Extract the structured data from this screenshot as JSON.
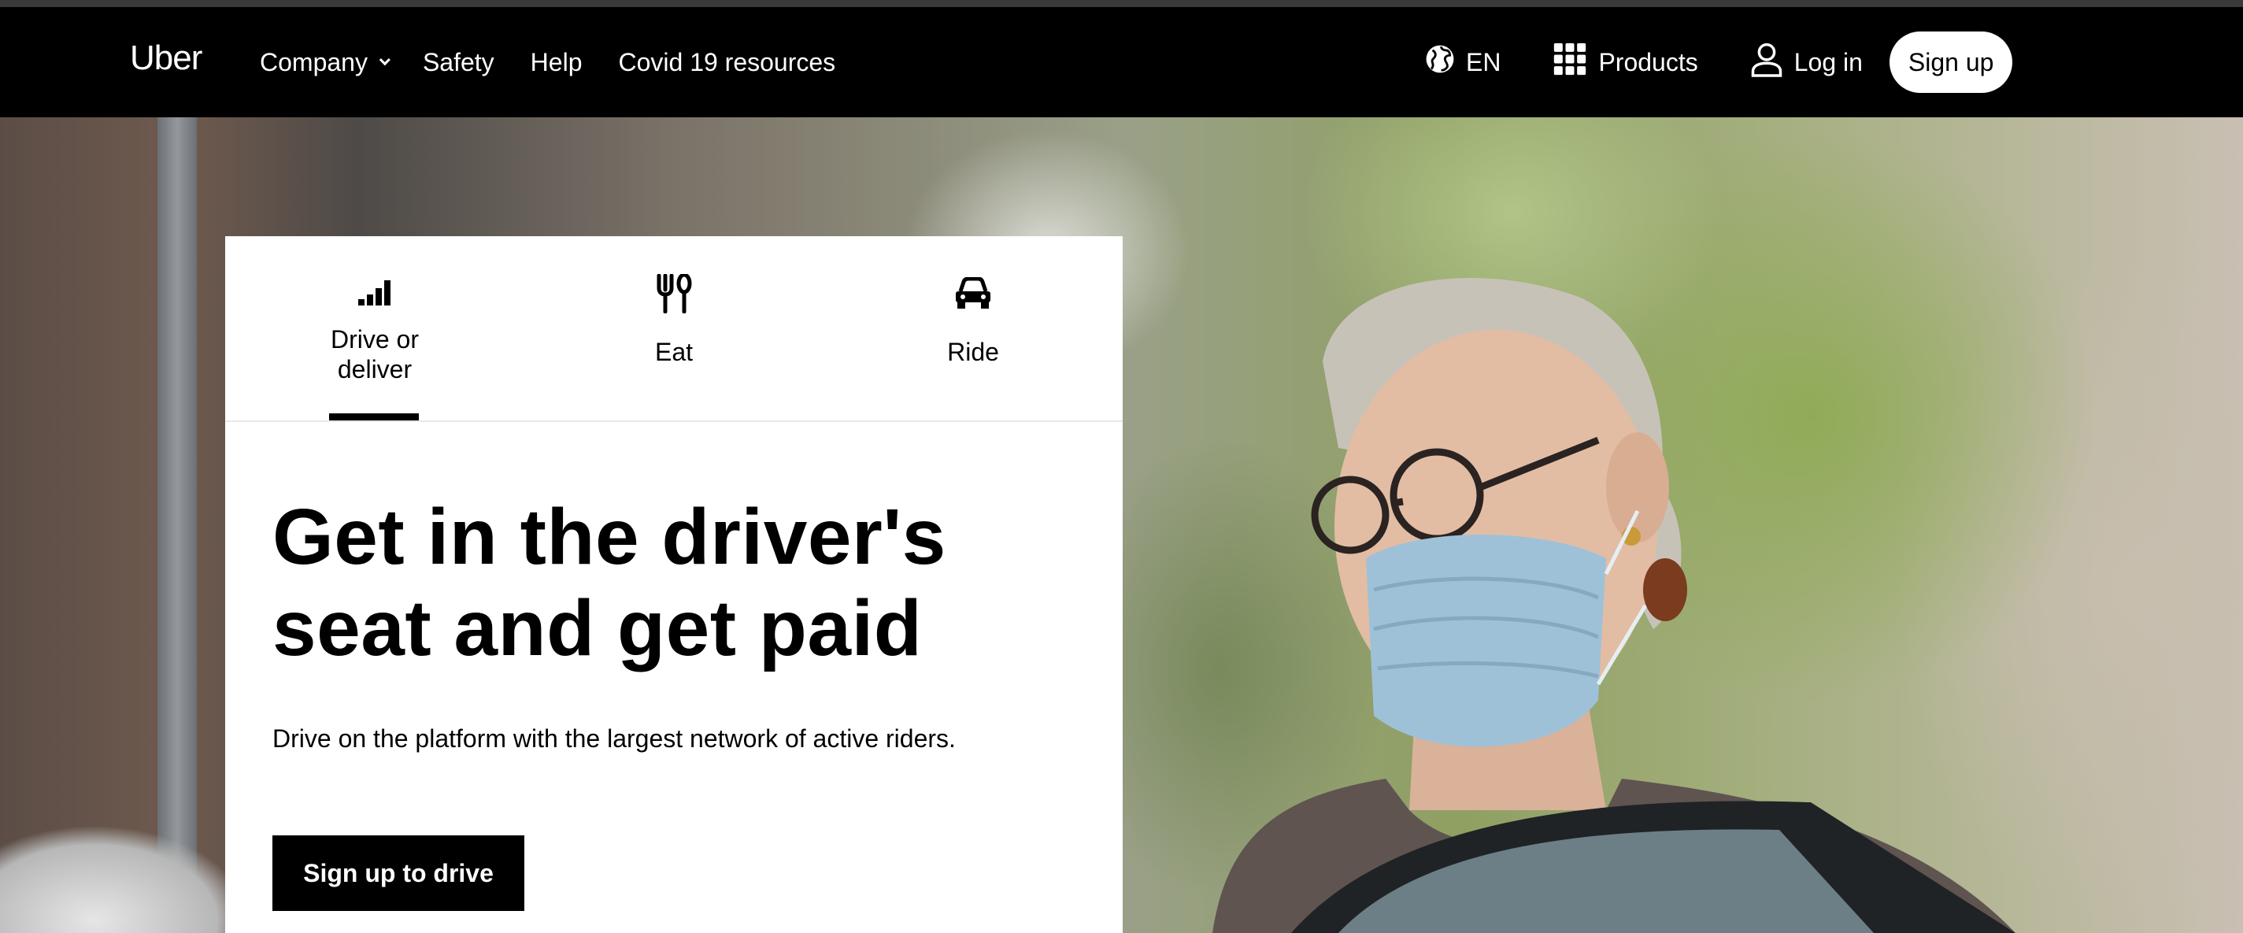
{
  "window": {
    "brand": "Uber"
  },
  "nav": {
    "company": "Company",
    "safety": "Safety",
    "help": "Help",
    "covid": "Covid 19 resources",
    "language": "EN",
    "products": "Products",
    "login": "Log in",
    "signup": "Sign up"
  },
  "tabs": [
    {
      "label": "Drive or deliver",
      "icon": "bars-icon",
      "selected": true
    },
    {
      "label": "Eat",
      "icon": "utensils-icon",
      "selected": false
    },
    {
      "label": "Ride",
      "icon": "car-icon",
      "selected": false
    }
  ],
  "hero": {
    "title": "Get in the driver's seat and get paid",
    "description": "Drive on the platform with the largest network of active riders.",
    "cta": "Sign up to drive"
  },
  "colors": {
    "nav_bg": "#000000",
    "card_bg": "#ffffff",
    "cta_bg": "#000000",
    "signup_bg": "#ffffff"
  }
}
